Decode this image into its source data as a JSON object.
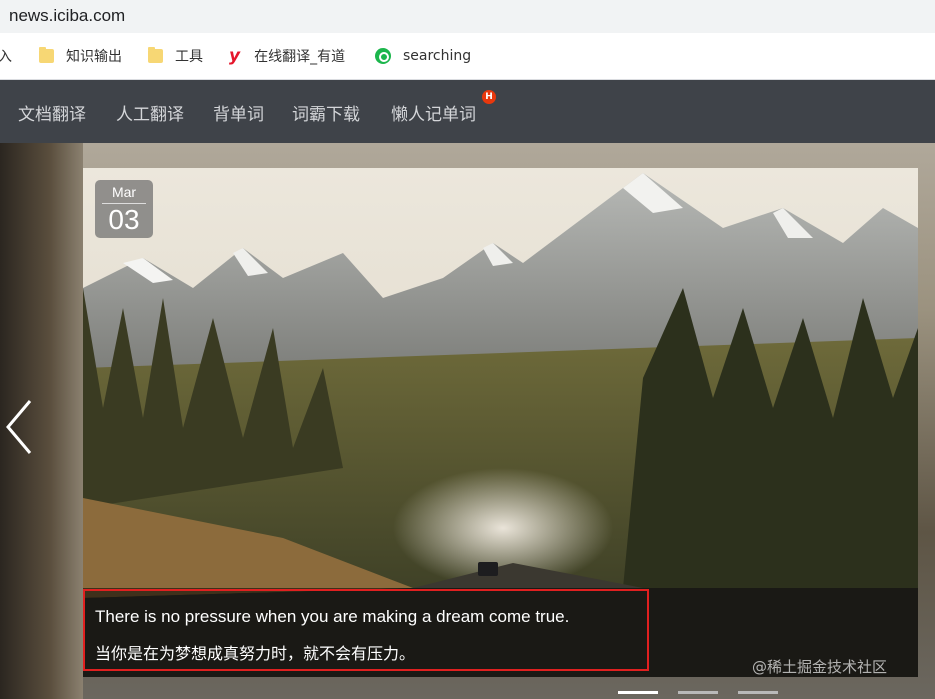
{
  "browser": {
    "url": "news.iciba.com"
  },
  "bookmarks": [
    {
      "label": "入",
      "icon": "none"
    },
    {
      "label": "知识输出",
      "icon": "folder-icon"
    },
    {
      "label": "工具",
      "icon": "folder-icon"
    },
    {
      "label": "在线翻译_有道",
      "icon": "youdao-logo-icon"
    },
    {
      "label": "searching",
      "icon": "search-icon"
    }
  ],
  "nav": {
    "items": [
      "文档翻译",
      "人工翻译",
      "背单词",
      "词霸下载",
      "懒人记单词"
    ],
    "badge": "H"
  },
  "slide": {
    "date_month": "Mar",
    "date_day": "03",
    "caption_en": "There is no pressure when you are making a dream come true.",
    "caption_zh": "当你是在为梦想成真努力时，就不会有压力。",
    "watermark": "@稀土掘金技术社区",
    "image_description_icon": "mountain-forest-road-photo"
  },
  "carousel": {
    "total_slides": 3,
    "active_index": 0
  },
  "colors": {
    "nav_bg": "#3f4349",
    "highlight_border": "#e02020",
    "badge": "#e8380d"
  }
}
